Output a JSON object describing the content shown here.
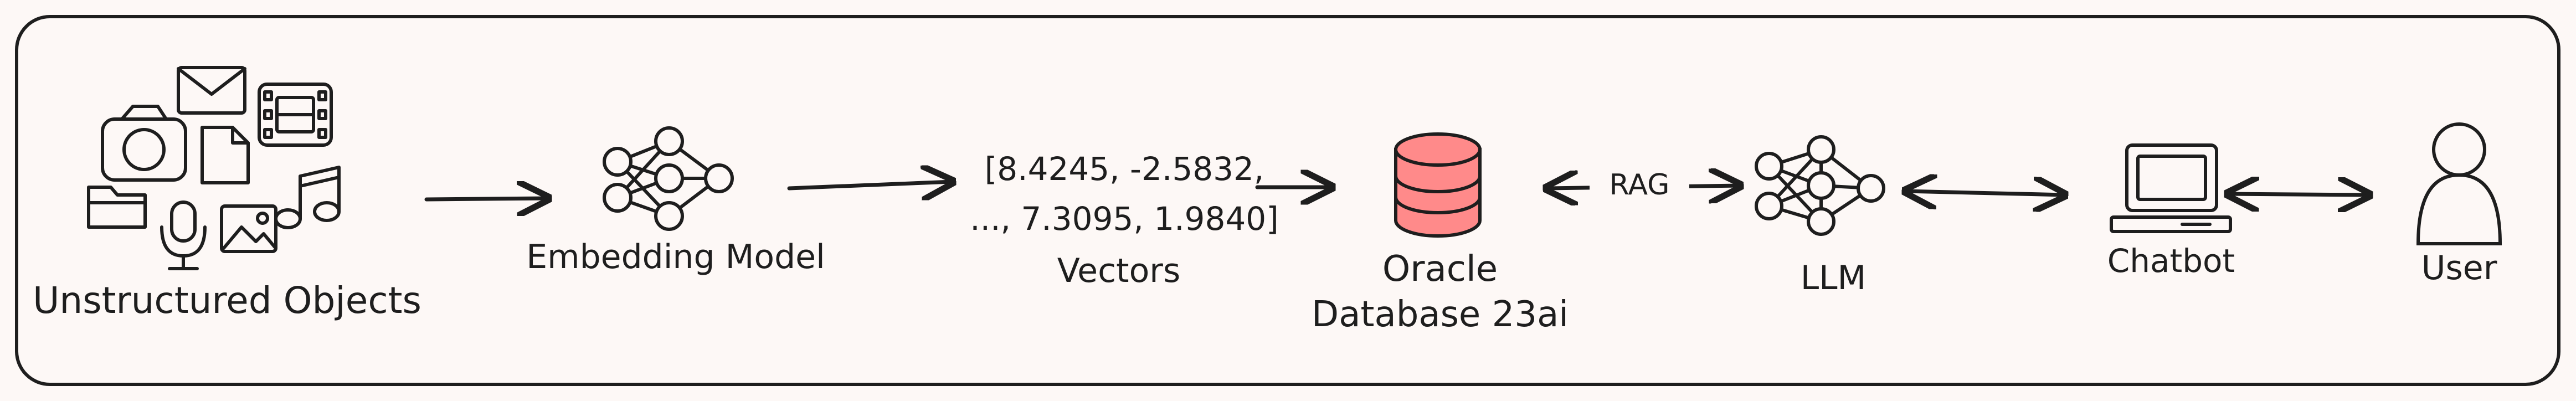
{
  "nodes": {
    "unstructured_objects": "Unstructured Objects",
    "embedding_model": "Embedding Model",
    "vector_line1": "[8.4245, -2.5832,",
    "vector_line2": "..., 7.3095, 1.9840]",
    "vectors": "Vectors",
    "oracle_line1": "Oracle",
    "oracle_line2": "Database 23ai",
    "llm": "LLM",
    "chatbot": "Chatbot",
    "user": "User"
  },
  "edges": {
    "rag_label": "RAG"
  },
  "colors": {
    "stroke": "#1e1e1e",
    "background": "#fdf8f6",
    "database_fill": "#ff8a8a"
  },
  "icons": [
    "camera-icon",
    "mail-icon",
    "film-icon",
    "document-icon",
    "music-icon",
    "folder-icon",
    "microphone-icon",
    "image-icon",
    "neural-network-icon",
    "database-icon",
    "computer-icon",
    "user-icon"
  ]
}
